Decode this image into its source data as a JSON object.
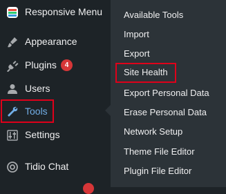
{
  "sidebar": {
    "items": [
      {
        "label": "Responsive Menu",
        "icon": "responsive-menu-logo-icon"
      },
      {
        "label": "Appearance",
        "icon": "paintbrush-icon"
      },
      {
        "label": "Plugins",
        "icon": "plug-icon",
        "badge": "4"
      },
      {
        "label": "Users",
        "icon": "user-icon"
      },
      {
        "label": "Tools",
        "icon": "wrench-icon",
        "current": true
      },
      {
        "label": "Settings",
        "icon": "sliders-icon"
      },
      {
        "label": "Tidio Chat",
        "icon": "chat-icon"
      }
    ]
  },
  "submenu": {
    "items": [
      {
        "label": "Available Tools"
      },
      {
        "label": "Import"
      },
      {
        "label": "Export"
      },
      {
        "label": "Site Health",
        "highlighted": true
      },
      {
        "label": "Export Personal Data"
      },
      {
        "label": "Erase Personal Data"
      },
      {
        "label": "Network Setup"
      },
      {
        "label": "Theme File Editor"
      },
      {
        "label": "Plugin File Editor"
      }
    ]
  },
  "colors": {
    "sidebar_bg": "#1d2327",
    "submenu_bg": "#2c3338",
    "text": "#f0f0f1",
    "current": "#72aee6",
    "badge": "#d63638",
    "highlight_border": "#e0001a"
  }
}
